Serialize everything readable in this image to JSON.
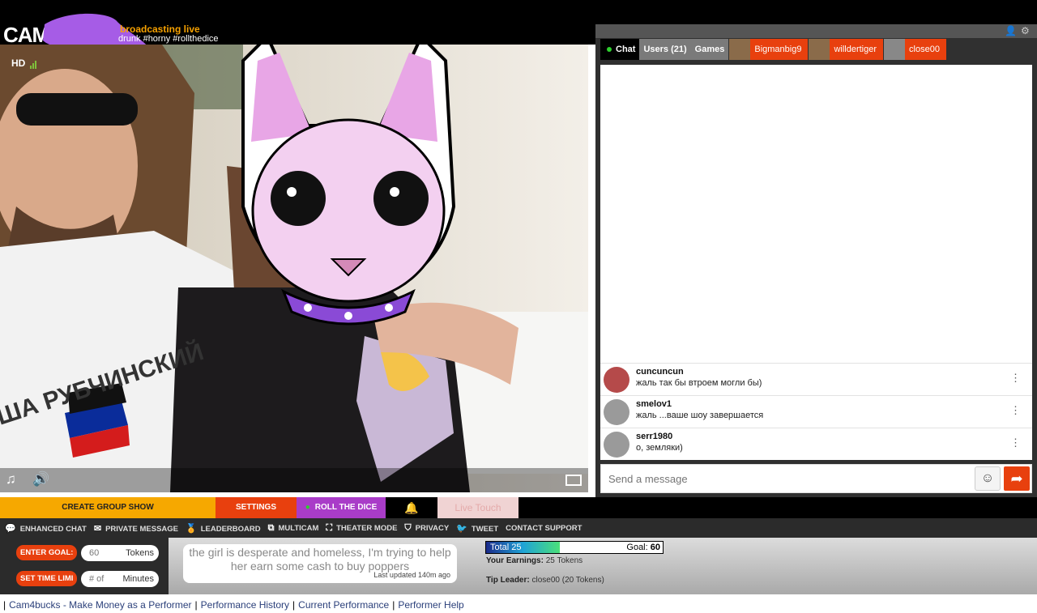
{
  "header": {
    "logo": "CAM4",
    "status": "broadcasting live",
    "tags": "drunk #horny #rollthedice"
  },
  "video": {
    "quality_label": "HD",
    "shirt_text": "ША РУБЧИНСКИЙ"
  },
  "chat": {
    "tabs": {
      "chat": "Chat",
      "users": "Users (21)",
      "games": "Games"
    },
    "user_tabs": [
      "Bigmanbig9",
      "willdertiger",
      "close00"
    ],
    "messages": [
      {
        "user": "cuncuncun",
        "text": "жаль так бы втроем могли бы)"
      },
      {
        "user": "smelov1",
        "text": "жаль ...ваше шоу завершается"
      },
      {
        "user": "serr1980",
        "text": "о, земляки)"
      }
    ],
    "input_placeholder": "Send a message"
  },
  "actions": {
    "create_group_show": "CREATE GROUP SHOW",
    "settings": "SETTINGS",
    "roll_the_dice": "ROLL THE DICE",
    "live_touch": "Live Touch"
  },
  "menu": {
    "enhanced_chat": "ENHANCED CHAT",
    "private_message": "PRIVATE MESSAGE",
    "leaderboard": "LEADERBOARD",
    "multicam": "MULTICAM",
    "theater_mode": "THEATER MODE",
    "privacy": "PRIVACY",
    "tweet": "TWEET",
    "contact_support": "CONTACT SUPPORT"
  },
  "goal": {
    "enter_goal_label": "ENTER GOAL:",
    "goal_value": "60",
    "goal_unit": "Tokens",
    "set_time_label": "SET TIME LIMI",
    "time_placeholder": "# of",
    "time_unit": "Minutes",
    "topic": "the girl is desperate and homeless, I'm trying to help her earn some cash to buy poppers",
    "last_updated": "Last updated 140m ago",
    "total_label": "Total 25",
    "goal_label": "Goal:",
    "goal_target": "60",
    "progress_fraction": 0.4167,
    "earnings_label": "Your Earnings:",
    "earnings_value": "25 Tokens",
    "tip_leader_label": "Tip Leader:",
    "tip_leader_value": "close00 (20 Tokens)"
  },
  "footer": {
    "links": [
      "Cam4bucks - Make Money as a Performer",
      "Performance History",
      "Current Performance",
      "Performer Help"
    ]
  },
  "colors": {
    "accent_orange": "#e8400e",
    "create_group_yellow": "#f6a800",
    "roll_dice_purple": "#a93cc8",
    "live_touch_pink": "#f0d3d3",
    "online_green": "#2fd02f"
  }
}
